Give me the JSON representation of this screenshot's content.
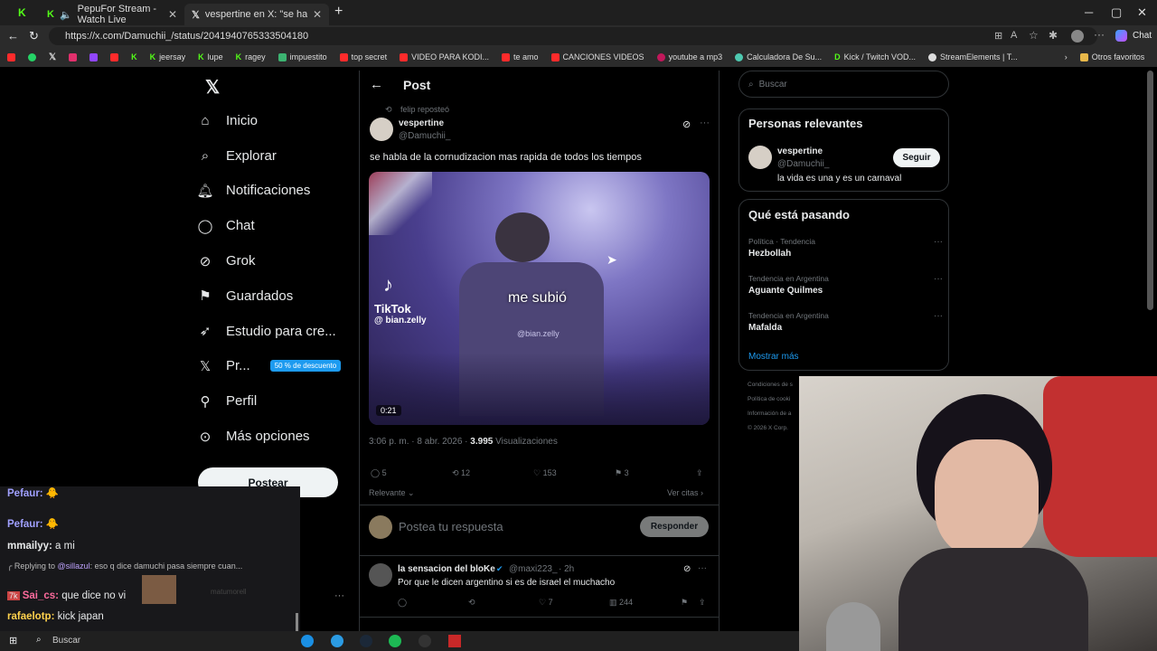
{
  "browser": {
    "tabs": [
      {
        "label": "PepuFor Stream - Watch Live",
        "active": false
      },
      {
        "label": "vespertine en X: \"se habla de la co",
        "active": true
      }
    ],
    "url": "https://x.com/Damuchii_/status/2041940765333504180",
    "copilot_label": "Chat",
    "bookmarks": [
      "jeersay",
      "lupe",
      "ragey",
      "impuestito",
      "top secret",
      "VIDEO PARA KODI...",
      "te amo",
      "CANCIONES VIDEOS",
      "youtube a mp3",
      "Calculadora De Su...",
      "Kick / Twitch VOD...",
      "StreamElements | T..."
    ],
    "other_favorites": "Otros favoritos"
  },
  "nav": {
    "items": [
      {
        "label": "Inicio",
        "icon": "home-icon"
      },
      {
        "label": "Explorar",
        "icon": "search-icon"
      },
      {
        "label": "Notificaciones",
        "icon": "bell-icon"
      },
      {
        "label": "Chat",
        "icon": "chat-icon"
      },
      {
        "label": "Grok",
        "icon": "grok-icon"
      },
      {
        "label": "Guardados",
        "icon": "bookmark-icon"
      },
      {
        "label": "Estudio para cre...",
        "icon": "rocket-icon"
      },
      {
        "label": "Pr...",
        "icon": "x-logo-icon"
      },
      {
        "label": "Perfil",
        "icon": "person-icon"
      },
      {
        "label": "Más opciones",
        "icon": "more-circle-icon"
      }
    ],
    "premium_badge": "50 % de descuento",
    "post_button": "Postear"
  },
  "post": {
    "header_title": "Post",
    "reposted_by": "felip reposteó",
    "author_name": "vespertine",
    "author_handle": "@Damuchii_",
    "text": "se habla de la cornudizacion mas rapida de todos los tiempos",
    "video": {
      "tiktok_label": "TikTok",
      "tiktok_user": "@ bian.zelly",
      "caption": "me subió",
      "watermark": "@bian.zelly",
      "duration": "0:21"
    },
    "timestamp": "3:06 p. m. · 8 abr. 2026 · ",
    "views_count": "3.995",
    "views_label": " Visualizaciones",
    "stats": {
      "replies": "5",
      "reposts": "12",
      "likes": "153",
      "bookmarks": "3"
    },
    "sort_label": "Relevante",
    "quotes_link": "Ver citas",
    "reply_placeholder": "Postea tu respuesta",
    "reply_button": "Responder"
  },
  "reply": {
    "author_name": "la sensacion del bloKe",
    "author_handle": "@maxi223_",
    "time": "· 2h",
    "text": "Por que le dicen argentino si es de israel el muchacho",
    "stats": {
      "likes": "7",
      "views": "244"
    }
  },
  "sidebar": {
    "search_placeholder": "Buscar",
    "relevant_title": "Personas relevantes",
    "person": {
      "name": "vespertine",
      "handle": "@Damuchii_",
      "bio": "la vida es una y es un carnaval",
      "follow": "Seguir"
    },
    "trending_title": "Qué está pasando",
    "trends": [
      {
        "context": "Política · Tendencia",
        "name": "Hezbollah"
      },
      {
        "context": "Tendencia en Argentina",
        "name": "Aguante Quilmes"
      },
      {
        "context": "Tendencia en Argentina",
        "name": "Mafalda"
      }
    ],
    "show_more": "Mostrar más",
    "footer": [
      "Condiciones de s",
      "Política de cooki",
      "Información de a",
      "© 2026 X Corp."
    ]
  },
  "chat": {
    "messages": [
      {
        "user": "Pefaur:",
        "text": "",
        "color": "#a0a0ff"
      },
      {
        "user": "Pefaur:",
        "text": "",
        "color": "#a0a0ff"
      },
      {
        "user": "mmailyy:",
        "text": " a mi",
        "color": "#ffffff"
      },
      {
        "user": "Sai_cs:",
        "text": " que dice no vi",
        "color": "#ff6b9d"
      },
      {
        "user": "rafaelotp:",
        "text": " kick japan",
        "color": "#ffd24d"
      }
    ],
    "reply_prefix": "Replying to ",
    "reply_mention": "@sillazul",
    "reply_text": ": eso q dice damuchi pasa siempre cuan...",
    "ghost_user": "matumorell"
  },
  "taskbar": {
    "search_label": "Buscar"
  }
}
